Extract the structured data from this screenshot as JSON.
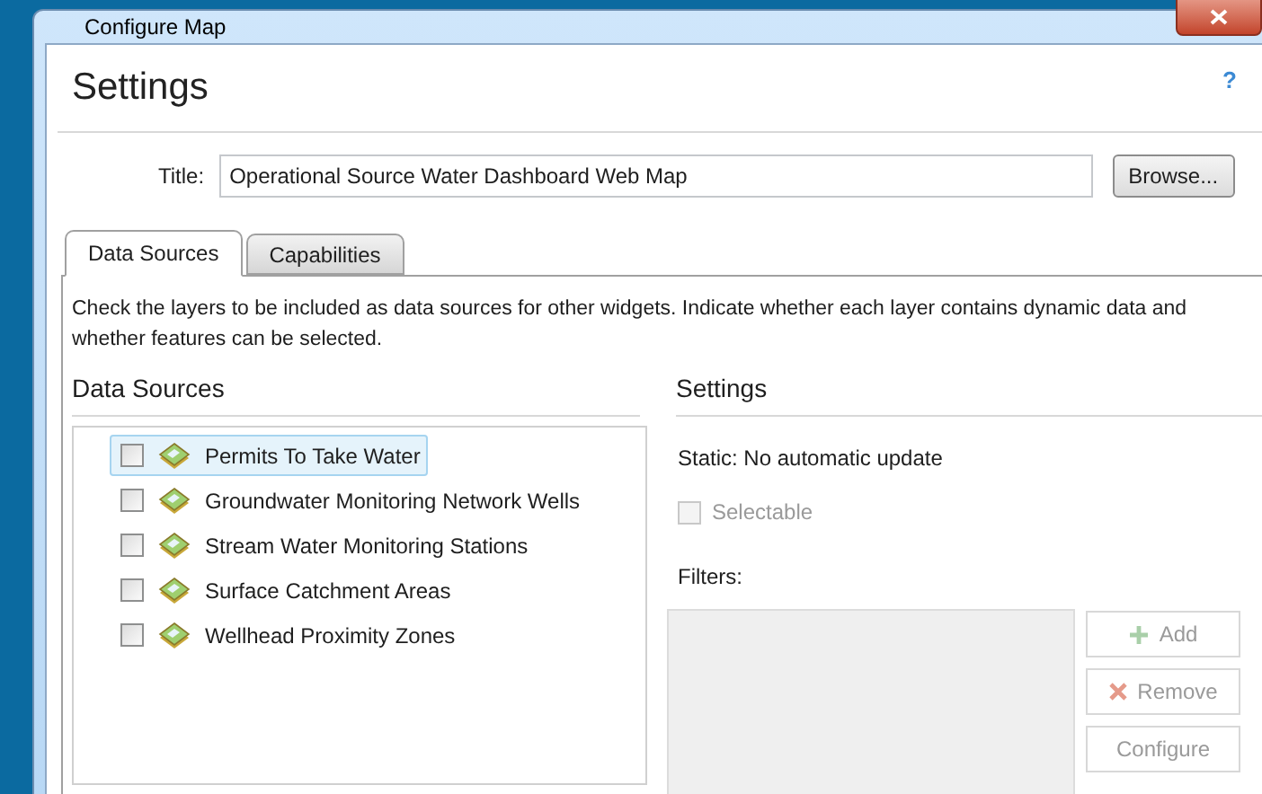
{
  "window": {
    "title": "Configure Map"
  },
  "header": {
    "title": "Settings",
    "help": "?"
  },
  "title_field": {
    "label": "Title:",
    "value": "Operational Source Water Dashboard Web Map",
    "button": "Browse..."
  },
  "tabs": [
    {
      "label": "Data Sources",
      "selected": true
    },
    {
      "label": "Capabilities",
      "selected": false
    }
  ],
  "description": "Check the layers to be included as data sources for other widgets. Indicate whether each layer contains dynamic data and whether features can be selected.",
  "data_sources": {
    "heading": "Data Sources",
    "layers": [
      {
        "name": "Permits To Take Water",
        "checked": false,
        "selected": true
      },
      {
        "name": "Groundwater Monitoring Network Wells",
        "checked": false,
        "selected": false
      },
      {
        "name": "Stream Water Monitoring Stations",
        "checked": false,
        "selected": false
      },
      {
        "name": "Surface Catchment Areas",
        "checked": false,
        "selected": false
      },
      {
        "name": "Wellhead Proximity Zones",
        "checked": false,
        "selected": false
      }
    ]
  },
  "settings": {
    "heading": "Settings",
    "mode": "Static: No automatic update",
    "selectable": {
      "label": "Selectable",
      "checked": false,
      "disabled": true
    },
    "filters_label": "Filters:",
    "buttons": [
      {
        "label": "Add",
        "kind": "add",
        "disabled": true
      },
      {
        "label": "Remove",
        "kind": "remove",
        "disabled": true
      },
      {
        "label": "Configure",
        "kind": "plain",
        "disabled": true
      }
    ]
  }
}
